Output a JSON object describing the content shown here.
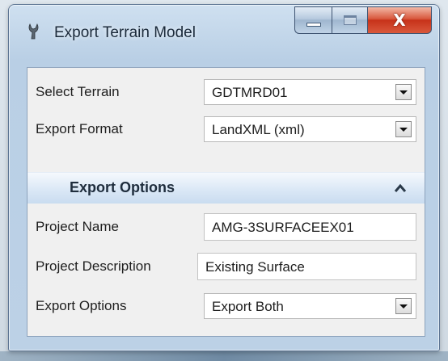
{
  "window": {
    "title": "Export Terrain Model",
    "close_glyph": "X"
  },
  "fields": {
    "select_terrain": {
      "label": "Select Terrain",
      "value": "GDTMRD01"
    },
    "export_format": {
      "label": "Export Format",
      "value": "LandXML (xml)"
    }
  },
  "export_options_section": {
    "title": "Export Options",
    "expanded": true,
    "fields": {
      "project_name": {
        "label": "Project Name",
        "value": "AMG-3SURFACEEX01"
      },
      "project_description": {
        "label": "Project Description",
        "value": "Existing Surface"
      },
      "export_options": {
        "label": "Export Options",
        "value": "Export Both"
      }
    }
  },
  "icons": {
    "app": "terrain-app-icon",
    "minimize": "minimize-icon",
    "maximize": "maximize-icon",
    "close": "close-icon",
    "collapse": "chevron-up-icon",
    "dropdown": "chevron-down-icon"
  },
  "colors": {
    "close_button": "#c7321a",
    "section_header": "#dbe8f6",
    "client_background": "#f0f0f0"
  }
}
